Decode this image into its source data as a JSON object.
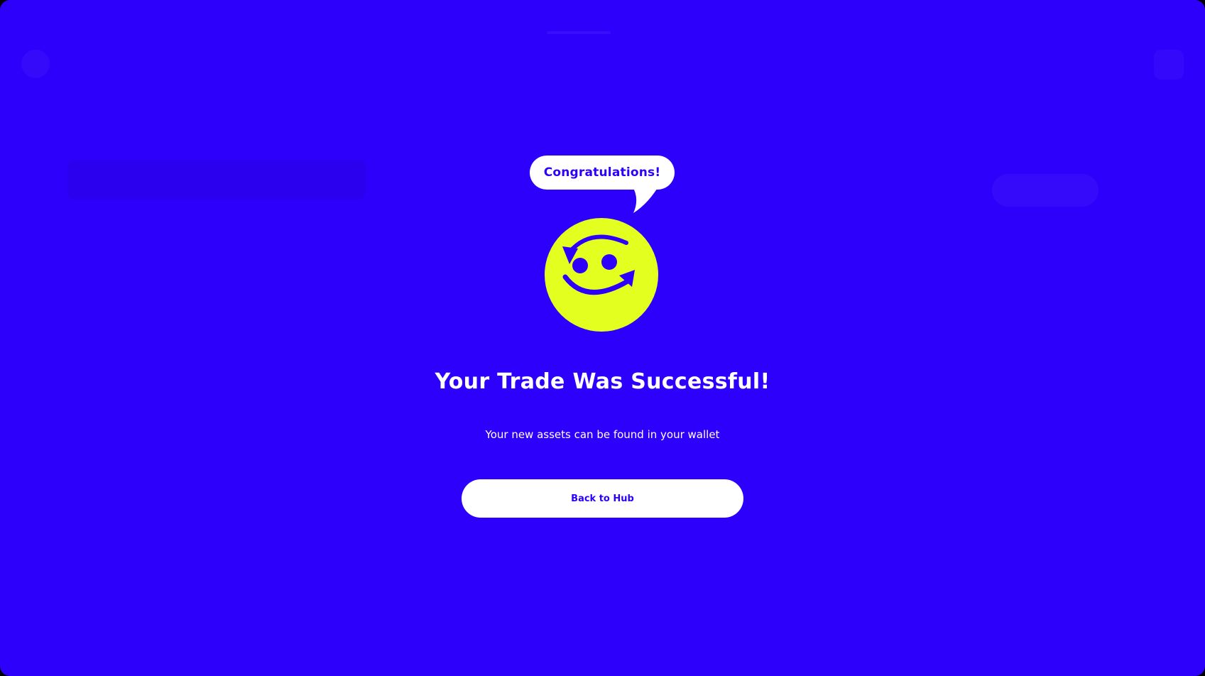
{
  "colors": {
    "background": "#2d00fb",
    "accent_yellow": "#e2ff1f",
    "white": "#ffffff"
  },
  "modal": {
    "bubble_text": "Congratulations!",
    "illustration_icon": "smiley-swap-icon",
    "headline": "Your Trade Was Successful!",
    "subtext": "Your new assets can be found in your wallet",
    "back_button_label": "Back to Hub"
  }
}
